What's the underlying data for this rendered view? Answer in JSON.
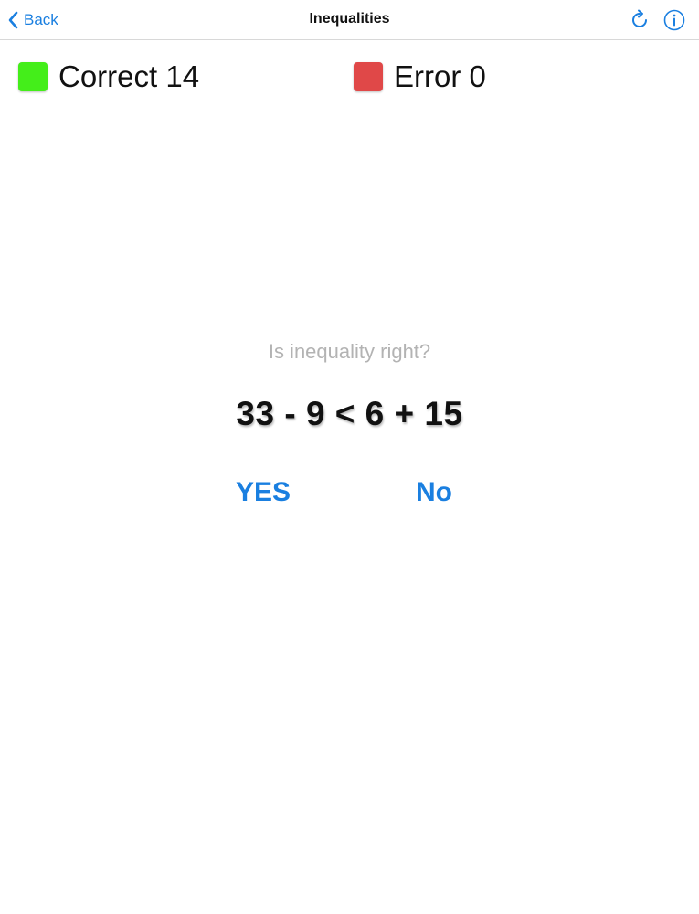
{
  "nav": {
    "back_label": "Back",
    "title": "Inequalities"
  },
  "scores": {
    "correct_label": "Correct 14",
    "error_label": "Error 0"
  },
  "question": {
    "prompt": "Is inequality right?",
    "expression": "33 - 9 < 6 + 15"
  },
  "answers": {
    "yes_label": "YES",
    "no_label": "No"
  },
  "colors": {
    "accent": "#1a7fe0",
    "correct": "#44ee1a",
    "error": "#e04848"
  },
  "icons": [
    "chevron-left-icon",
    "refresh-icon",
    "info-icon"
  ]
}
